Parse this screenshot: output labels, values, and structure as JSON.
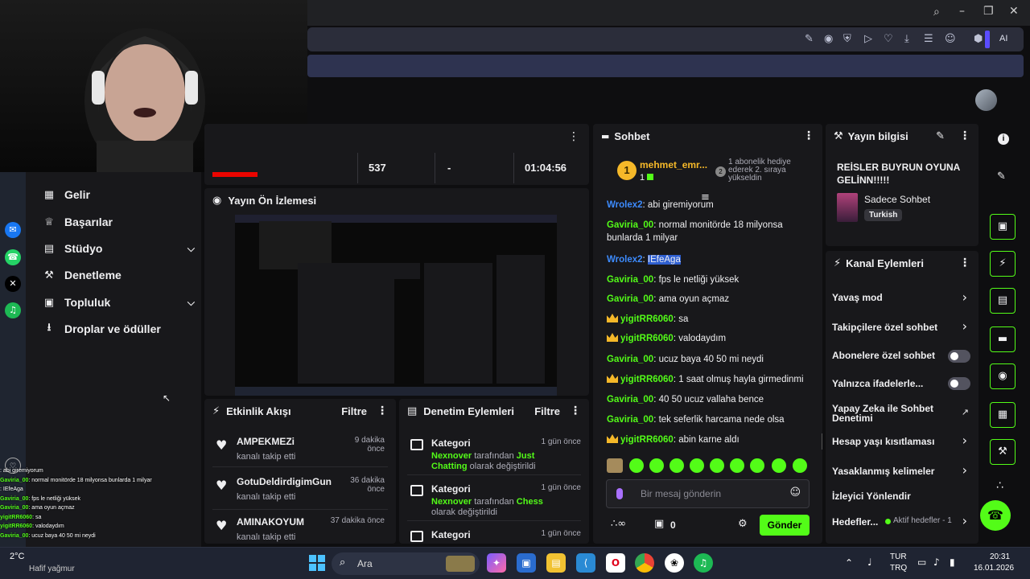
{
  "browser": {
    "window_controls": [
      "search-icon",
      "minimize-icon",
      "restore-icon",
      "close-icon"
    ],
    "toolbar_icons": [
      "edit-icon",
      "camera-icon",
      "shield-icon",
      "play-icon",
      "heart-icon",
      "download-icon",
      "menu-icon",
      "profile-icon",
      "cube-icon"
    ],
    "ai_label": "AI"
  },
  "sidebar": {
    "items": [
      {
        "label": "Gelir",
        "icon": "chart-icon"
      },
      {
        "label": "Başarılar",
        "icon": "trophy-icon"
      },
      {
        "label": "Stüdyo",
        "icon": "studio-icon",
        "expandable": true
      },
      {
        "label": "Denetleme",
        "icon": "wrench-icon"
      },
      {
        "label": "Topluluk",
        "icon": "community-icon",
        "expandable": true
      },
      {
        "label": "Droplar ve ödüller",
        "icon": "gift-icon"
      }
    ]
  },
  "stats": {
    "viewers": "537",
    "dash": "-",
    "uptime": "01:04:56"
  },
  "preview": {
    "title": "Yayın Ön İzlemesi"
  },
  "activity": {
    "title": "Etkinlik Akışı",
    "filter": "Filtre",
    "items": [
      {
        "name": "AMPEKMEZi",
        "sub": "kanalı takip etti",
        "time": "9 dakika önce"
      },
      {
        "name": "GotuDeldirdigimGun",
        "sub": "kanalı takip etti",
        "time": "36 dakika önce"
      },
      {
        "name": "AMINAKOYUM",
        "sub": "kanalı takip etti",
        "time": "37 dakika önce"
      }
    ]
  },
  "moderation": {
    "title": "Denetim Eylemleri",
    "filter": "Filtre",
    "items": [
      {
        "name": "Kategori",
        "time": "1 gün önce",
        "actor": "Nexnover",
        "mid": " tarafından ",
        "value": "Just Chatting",
        "end": " olarak değiştirildi"
      },
      {
        "name": "Kategori",
        "time": "1 gün önce",
        "actor": "Nexnover",
        "mid": " tarafından ",
        "value": "Chess",
        "end": " olarak değiştirildi"
      },
      {
        "name": "Kategori",
        "time": "1 gün önce"
      }
    ]
  },
  "chat": {
    "title": "Sohbet",
    "top_gifter": {
      "name": "mehmet_emr...",
      "count": "1",
      "rank": "1"
    },
    "gift_text": "1 abonelik hediye ederek 2. sıraya yükseldin",
    "messages": [
      {
        "user": "Wrolex2",
        "text": "abi giremiyorum",
        "color": "#3d8bfd"
      },
      {
        "user": "Gaviria_00",
        "text": "normal monitörde 18 milyonsa bunlarda 1 milyar",
        "color": "#53fc18"
      },
      {
        "user": "Wrolex2",
        "text": "IEfeAga",
        "color": "#3d8bfd",
        "highlight": true
      },
      {
        "user": "Gaviria_00",
        "text": "fps le netliği yüksek",
        "color": "#53fc18"
      },
      {
        "user": "Gaviria_00",
        "text": "ama oyun açmaz",
        "color": "#53fc18"
      },
      {
        "user": "yigitRR6060",
        "text": "sa",
        "color": "#53fc18",
        "crown": true
      },
      {
        "user": "yigitRR6060",
        "text": "valodaydım",
        "color": "#53fc18",
        "crown": true
      },
      {
        "user": "Gaviria_00",
        "text": "ucuz baya 40 50 mi neydi",
        "color": "#53fc18"
      },
      {
        "user": "yigitRR6060",
        "text": "1 saat olmuş hayla girmedinmi",
        "color": "#53fc18",
        "crown": true
      },
      {
        "user": "Gaviria_00",
        "text": "40 50 ucuz vallaha bence",
        "color": "#53fc18"
      },
      {
        "user": "Gaviria_00",
        "text": "tek seferlik harcama nede olsa",
        "color": "#53fc18"
      },
      {
        "user": "yigitRR6060",
        "text": "abin karne aldı",
        "color": "#53fc18",
        "crown": true
      }
    ],
    "input_placeholder": "Bir mesaj gönderin",
    "send_label": "Gönder",
    "points": "0"
  },
  "stream_info": {
    "title": "Yayın bilgisi",
    "stream_title": "REİSLER BUYRUN OYUNA GELİNN!!!!!",
    "category": "Sadece Sohbet",
    "language": "Turkish"
  },
  "channel_actions": {
    "title": "Kanal Eylemleri",
    "items": [
      {
        "label": "Yavaş mod",
        "type": "arrow"
      },
      {
        "label": "Takipçilere özel sohbet",
        "type": "arrow"
      },
      {
        "label": "Abonelere özel sohbet",
        "type": "toggle"
      },
      {
        "label": "Yalnızca ifadelerle...",
        "type": "toggle"
      },
      {
        "label": "Yapay Zeka ile Sohbet Denetimi",
        "type": "external"
      },
      {
        "label": "Hesap yaşı kısıtlaması",
        "type": "arrow"
      },
      {
        "label": "Yasaklanmış kelimeler",
        "type": "arrow"
      },
      {
        "label": "İzleyici Yönlendir",
        "type": "none"
      },
      {
        "label": "Hedefler...",
        "type": "arrow",
        "extra": "Aktif hedefler - 1"
      }
    ]
  },
  "overlay_chat": [
    {
      "user": "",
      "text": ": abi giremiyorum"
    },
    {
      "user": "Gaviria_00",
      "text": ": normal monitörde 18 milyonsa bunlarda 1 milyar"
    },
    {
      "user": "",
      "text": ": IEfeAga"
    },
    {
      "user": "Gaviria_00",
      "text": ": fps le netliği yüksek"
    },
    {
      "user": "Gaviria_00",
      "text": ": ama oyun açmaz"
    },
    {
      "user": "yigitRR6060",
      "text": ": sa"
    },
    {
      "user": "yigitRR6060",
      "text": ": valodaydım"
    },
    {
      "user": "Gaviria_00",
      "text": ": ucuz baya 40 50 mi neydi"
    }
  ],
  "taskbar": {
    "search_label": "Ara",
    "weather_temp": "2°C",
    "weather_desc": "Hafif yağmur",
    "lang_top": "TUR",
    "lang_bottom": "TRQ",
    "time": "20:31",
    "date": "16.01.2026"
  }
}
